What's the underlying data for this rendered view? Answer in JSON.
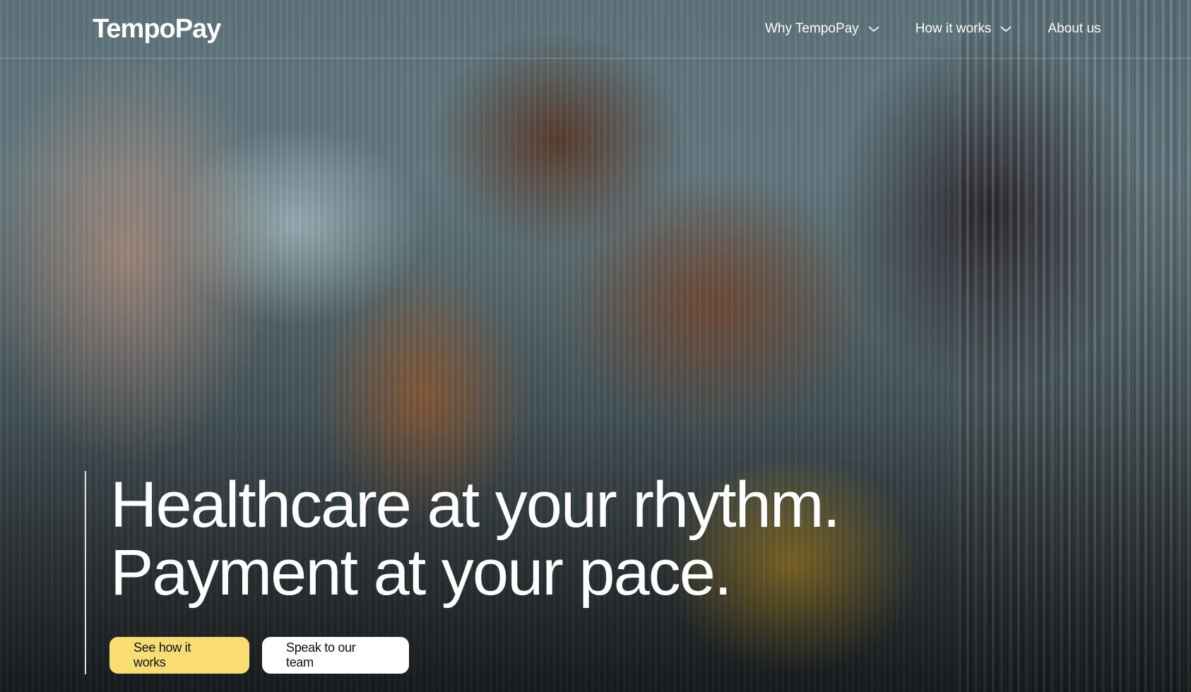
{
  "brand": {
    "logo_text": "TempoPay"
  },
  "nav": {
    "items": [
      {
        "label": "Why TempoPay",
        "has_dropdown": true
      },
      {
        "label": "How it works",
        "has_dropdown": true
      },
      {
        "label": "About us",
        "has_dropdown": false
      }
    ]
  },
  "hero": {
    "image": "hero-photo-doctor-father-child-teddy-bear",
    "headline_line1": "Healthcare at your rhythm.",
    "headline_line2": "Payment at your pace.",
    "cta_primary": "See how it works",
    "cta_secondary": "Speak to our team"
  },
  "colors": {
    "primary_button": "#f7dd74",
    "secondary_button": "#ffffff",
    "text_on_hero": "#ffffff"
  }
}
